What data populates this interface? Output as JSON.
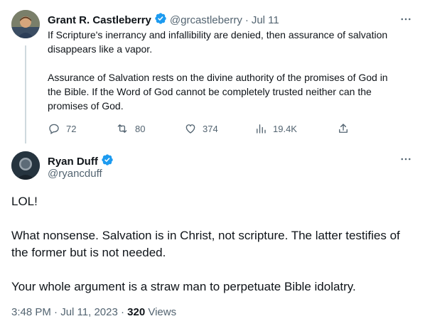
{
  "parent_tweet": {
    "author_name": "Grant R. Castleberry",
    "handle": "@grcastleberry",
    "separator": "·",
    "date": "Jul 11",
    "paragraph_1": "If Scripture's inerrancy and infallibility are denied, then assurance of salvation disappears like a vapor.",
    "paragraph_2": "Assurance of Salvation rests on the divine authority of the promises of God in the Bible. If the Word of God cannot be completely trusted neither can the promises of God.",
    "stats": {
      "replies": "72",
      "retweets": "80",
      "likes": "374",
      "views": "19.4K"
    }
  },
  "main_tweet": {
    "author_name": "Ryan Duff",
    "handle": "@ryancduff",
    "paragraph_1": "LOL!",
    "paragraph_2": "What nonsense. Salvation is in Christ, not scripture. The latter testifies of the former but is not needed.",
    "paragraph_3": "Your whole argument is a straw man to perpetuate Bible idolatry.",
    "timestamp": "3:48 PM · Jul 11, 2023 ·",
    "view_count": "320",
    "views_label": "Views"
  },
  "colors": {
    "verified_blue": "#1d9bf0",
    "text_primary": "#0f1419",
    "text_secondary": "#536471",
    "thread_line": "#cfd9de"
  },
  "icons": [
    "verified-badge-icon",
    "more-icon",
    "reply-icon",
    "retweet-icon",
    "like-icon",
    "views-icon",
    "share-icon"
  ]
}
